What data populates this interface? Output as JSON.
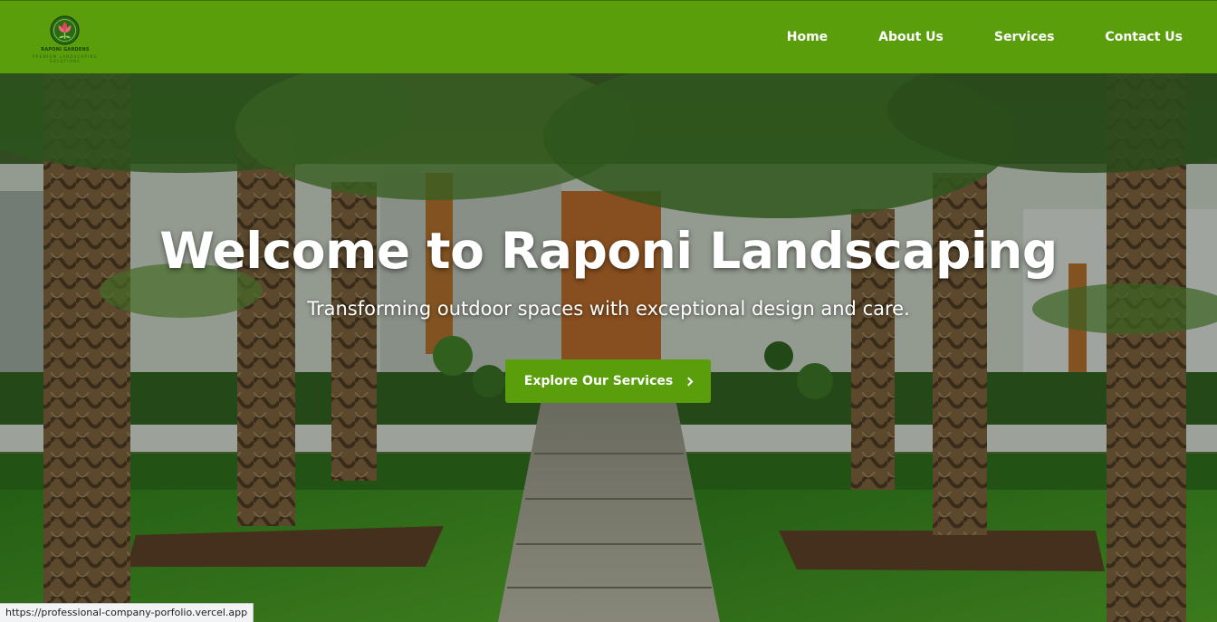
{
  "logo": {
    "name": "RAPONI GARDENS",
    "tagline": "PREMIUM LANDSCAPING SOLUTIONS",
    "icon": "flower-in-circle-logo"
  },
  "nav": {
    "items": [
      {
        "label": "Home"
      },
      {
        "label": "About Us"
      },
      {
        "label": "Services"
      },
      {
        "label": "Contact Us"
      }
    ]
  },
  "hero": {
    "title": "Welcome to Raponi Landscaping",
    "subtitle": "Transforming outdoor spaces with exceptional design and care.",
    "cta_label": "Explore Our Services",
    "cta_icon": "chevron-right-icon"
  },
  "status_bar": {
    "url": "https://professional-company-porfolio.vercel.app"
  },
  "colors": {
    "brand_green": "#5a9e0c",
    "text_light": "#ffffff"
  }
}
